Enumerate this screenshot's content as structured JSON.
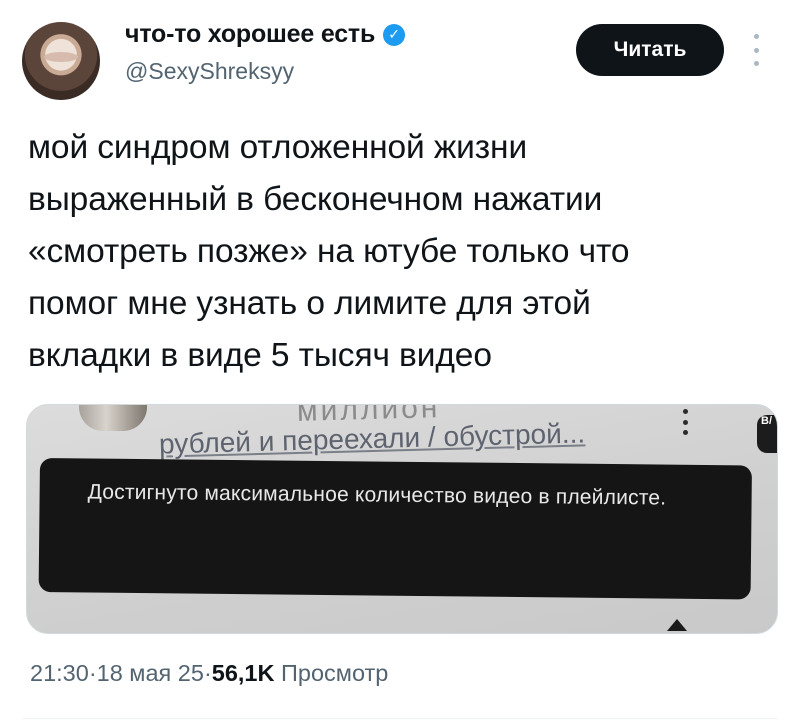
{
  "author": {
    "display_name": "что-то хорошее есть",
    "handle": "@SexyShreksyy",
    "verified_icon": "verified-badge-icon"
  },
  "actions": {
    "read_button_label": "Читать",
    "more_icon": "more-vertical-icon"
  },
  "tweet": {
    "text": "мой синдром отложенной жизни\nвыраженный в бесконечном нажатии\n«смотреть позже» на ютубе только что\nпомог мне узнать о лимите для этой\nвкладки в виде 5 тысяч видео"
  },
  "media": {
    "partial_top_text": "миллион",
    "video_subtitle": "рублей и переехали / обустрой...",
    "toast_message": "Достигнуто максимальное количество видео в плейлисте.",
    "corner_badge": "B/"
  },
  "meta": {
    "time": "21:30",
    "separator": " · ",
    "date": "18 мая 25",
    "views_count": "56,1K",
    "views_label": "Просмотр"
  },
  "colors": {
    "verified": "#1d9bf0",
    "button_bg": "#0f1419",
    "meta_gray": "#536471"
  }
}
